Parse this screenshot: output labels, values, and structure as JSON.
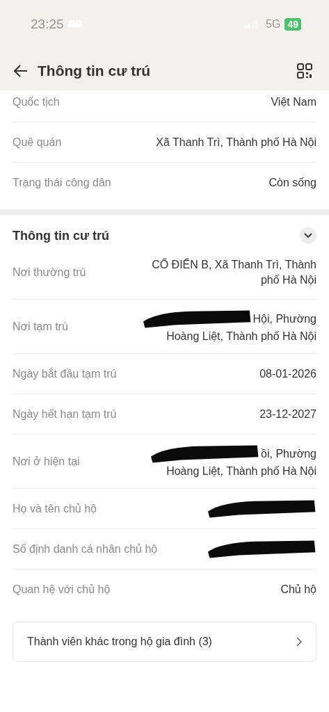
{
  "status_bar": {
    "time": "23:25",
    "network": "5G",
    "battery": "49"
  },
  "header": {
    "title": "Thông tin cư trú"
  },
  "top_rows": [
    {
      "label": "Quốc tịch",
      "lines": [
        "Việt Nam"
      ]
    },
    {
      "label": "Quê quán",
      "lines": [
        "Xã Thanh Trì, Thành phố Hà Nội"
      ]
    },
    {
      "label": "Trạng thái công dân",
      "lines": [
        "Còn sống"
      ]
    }
  ],
  "section": {
    "title": "Thông tin cư trú",
    "expanded": true,
    "rows": [
      {
        "label": "Nơi thường trú",
        "lines": [
          "CỔ ĐIỂN B, Xã Thanh Trì, Thành",
          "phố Hà Nội"
        ],
        "redacted": false
      },
      {
        "label": "Nơi tạm trú",
        "lines": [
          "Hội, Phường",
          "Hoàng Liệt, Thành phố Hà Nội"
        ],
        "redacted": true
      },
      {
        "label": "Ngày bắt đầu tạm trú",
        "lines": [
          "08-01-2026"
        ],
        "redacted": false
      },
      {
        "label": "Ngày hết hạn tạm trú",
        "lines": [
          "23-12-2027"
        ],
        "redacted": false
      },
      {
        "label": "Nơi ở hiện tại",
        "lines": [
          "ồi, Phường",
          "Hoàng Liệt, Thành phố Hà Nội"
        ],
        "redacted": true
      },
      {
        "label": "Họ và tên chủ hộ",
        "lines": [],
        "redacted": true
      },
      {
        "label": "Số định danh cá nhân chủ hộ",
        "lines": [],
        "redacted": true
      },
      {
        "label": "Quan hệ với chủ hộ",
        "lines": [
          "Chủ hộ"
        ],
        "redacted": false
      }
    ]
  },
  "members_link": {
    "label": "Thành viên khác trong hộ gia đình (3)"
  }
}
